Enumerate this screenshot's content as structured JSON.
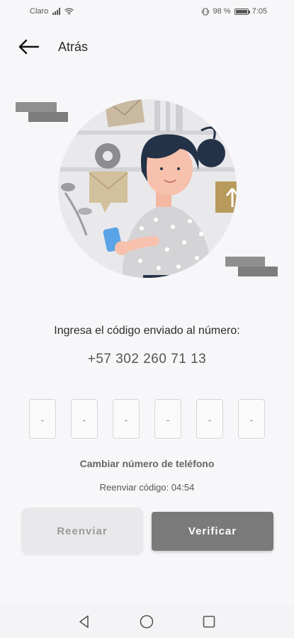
{
  "status_bar": {
    "carrier": "Claro",
    "battery_percent": "98 %",
    "battery_level": 0.98,
    "time": "7:05"
  },
  "header": {
    "back_label": "Atrás",
    "back_icon": "arrow-left-icon"
  },
  "verification": {
    "prompt": "Ingresa el código enviado al número:",
    "phone_number": "+57 302 260 71 13",
    "code_digits": [
      "-",
      "-",
      "-",
      "-",
      "-",
      "-"
    ],
    "change_number_link": "Cambiar número de teléfono",
    "resend_countdown": "Reenviar código: 04:54"
  },
  "actions": {
    "resend_label": "Reenviar",
    "verify_label": "Verificar"
  },
  "colors": {
    "background": "#f7f7f9",
    "verify_button": "#7a7a7a",
    "resend_button": "#e9e9ec"
  },
  "nav_icons": [
    "back-triangle-icon",
    "home-circle-icon",
    "recents-square-icon"
  ]
}
